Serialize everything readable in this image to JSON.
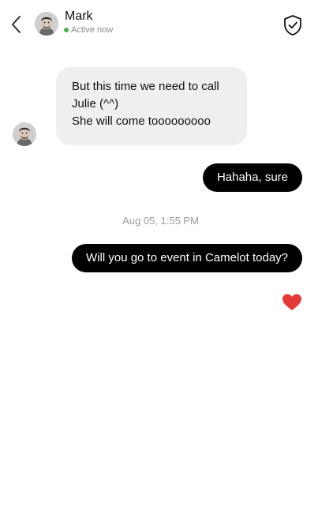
{
  "header": {
    "name": "Mark",
    "status": "Active now",
    "status_color": "#4caf50"
  },
  "icons": {
    "back": "chevron-left-icon",
    "security": "shield-check-icon",
    "reaction": "heart-icon"
  },
  "colors": {
    "incoming_bubble": "#efefef",
    "outgoing_bubble": "#000000",
    "heart": "#e53935"
  },
  "messages": [
    {
      "direction": "incoming",
      "lines": [
        "But this time we need to call",
        "Julie (^^)",
        "She will come tooooooooo"
      ]
    },
    {
      "direction": "outgoing",
      "text": "Hahaha, sure"
    },
    {
      "direction": "outgoing",
      "text": "Will you go to event in Camelot today?",
      "reaction": "heart"
    }
  ],
  "timestamp": "Aug 05, 1:55 PM"
}
